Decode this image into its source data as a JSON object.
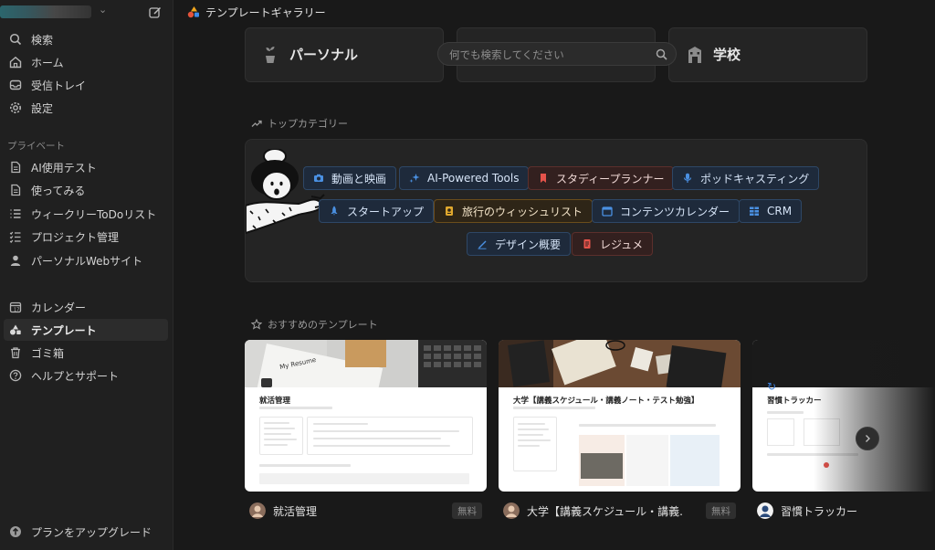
{
  "topbar": {
    "title": "テンプレートギャラリー"
  },
  "sidebar": {
    "main_items": [
      {
        "label": "検索",
        "icon": "search-icon"
      },
      {
        "label": "ホーム",
        "icon": "home-icon"
      },
      {
        "label": "受信トレイ",
        "icon": "inbox-icon"
      },
      {
        "label": "設定",
        "icon": "gear-icon"
      }
    ],
    "private_label": "プライベート",
    "private_items": [
      {
        "label": "AI使用テスト",
        "icon": "page-icon"
      },
      {
        "label": "使ってみる",
        "icon": "page-icon"
      },
      {
        "label": "ウィークリーToDoリスト",
        "icon": "list-icon"
      },
      {
        "label": "プロジェクト管理",
        "icon": "checklist-icon"
      },
      {
        "label": "パーソナルWebサイト",
        "icon": "person-icon"
      }
    ],
    "bottom_items": [
      {
        "label": "カレンダー",
        "icon": "calendar-icon"
      },
      {
        "label": "テンプレート",
        "icon": "shapes-icon",
        "active": true
      },
      {
        "label": "ゴミ箱",
        "icon": "trash-icon"
      },
      {
        "label": "ヘルプとサポート",
        "icon": "help-icon"
      }
    ],
    "upgrade_label": "プランをアップグレード"
  },
  "categories": [
    {
      "label": "パーソナル",
      "icon": "plant-icon"
    },
    {
      "label": "",
      "icon": ""
    },
    {
      "label": "学校",
      "icon": "school-icon"
    }
  ],
  "search": {
    "placeholder": "何でも検索してください"
  },
  "top_categories": {
    "heading": "トップカテゴリー",
    "tags": [
      {
        "label": "動画と映画",
        "icon": "camera-icon",
        "color": "blue"
      },
      {
        "label": "AI-Powered Tools",
        "icon": "sparkle-icon",
        "color": "blue"
      },
      {
        "label": "スタディープランナー",
        "icon": "bookmark-icon",
        "color": "red"
      },
      {
        "label": "ポッドキャスティング",
        "icon": "microphone-icon",
        "color": "blue"
      },
      {
        "label": "スタートアップ",
        "icon": "rocket-icon",
        "color": "blue"
      },
      {
        "label": "旅行のウィッシュリスト",
        "icon": "passport-icon",
        "color": "yellow"
      },
      {
        "label": "コンテンツカレンダー",
        "icon": "calendar-icon",
        "color": "blue"
      },
      {
        "label": "CRM",
        "icon": "grid-icon",
        "color": "blue"
      },
      {
        "label": "デザイン概要",
        "icon": "pen-icon",
        "color": "blue"
      },
      {
        "label": "レジュメ",
        "icon": "document-icon",
        "color": "red"
      }
    ]
  },
  "recommended": {
    "heading": "おすすめのテンプレート",
    "templates": [
      {
        "name": "就活管理",
        "preview_title": "就活管理",
        "preview_overlay": "My Resume",
        "badge": "無料"
      },
      {
        "name": "大学【講義スケジュール・講義...",
        "preview_title": "大学【講義スケジュール・講義ノート・テスト勉強】",
        "badge": "無料"
      },
      {
        "name": "習慣トラッカー",
        "preview_title": "習慣トラッカー",
        "badge": ""
      }
    ]
  }
}
